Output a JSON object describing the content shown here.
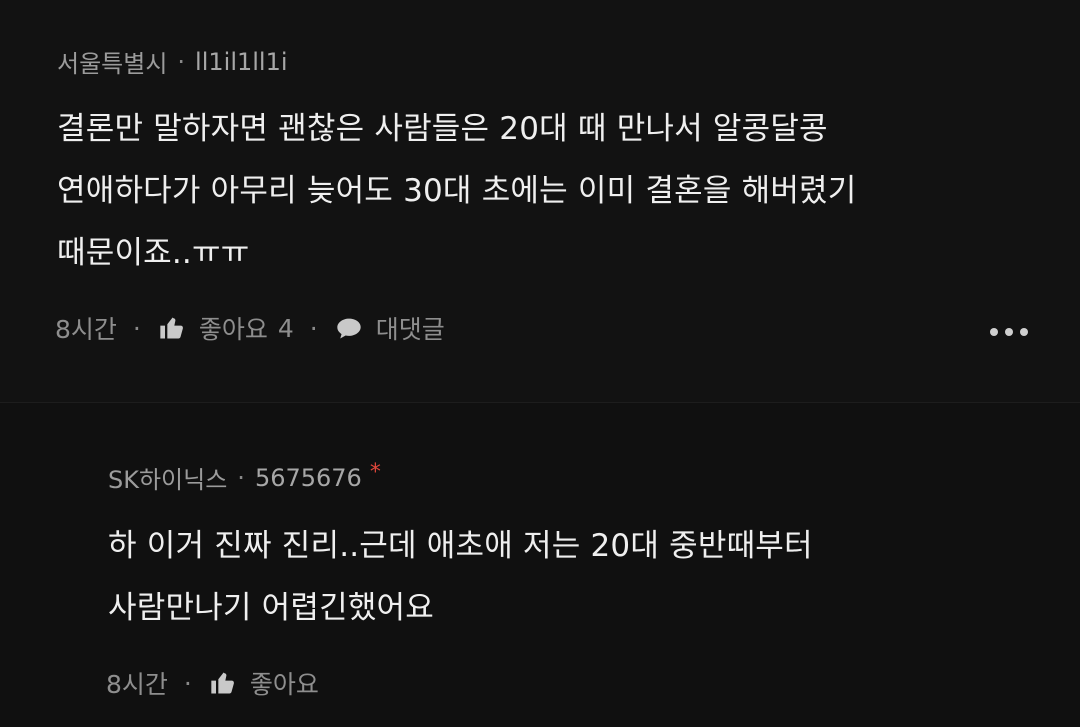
{
  "main_comment": {
    "location": "서울특별시",
    "user_id": "ll1il1ll1i",
    "lines": [
      "결론만 말하자면 괜찮은 사람들은 20대 때 만나서 알콩달콩",
      "연애하다가 아무리 늦어도 30대 초에는 이미 결혼을 해버렸기",
      "때문이죠..ㅠㅠ"
    ],
    "time": "8시간",
    "like_label": "좋아요",
    "like_count": "4",
    "reply_label": "대댓글",
    "icons": {
      "like": "thumbs-up-icon",
      "reply": "speech-bubble-icon",
      "more": "more-dots-icon"
    }
  },
  "reply_comment": {
    "location": "SK하이닉스",
    "user_id": "5675676",
    "author_mark": "*",
    "lines": [
      "하 이거 진짜 진리..근데 애초애 저는 20대 중반때부터",
      "사람만나기 어렵긴했어요"
    ],
    "time": "8시간",
    "like_label": "좋아요",
    "icons": {
      "like": "thumbs-up-icon"
    }
  },
  "colors": {
    "background": "#121212",
    "text": "#efefef",
    "meta": "#9b9b9b",
    "author_mark": "#e0463a"
  }
}
